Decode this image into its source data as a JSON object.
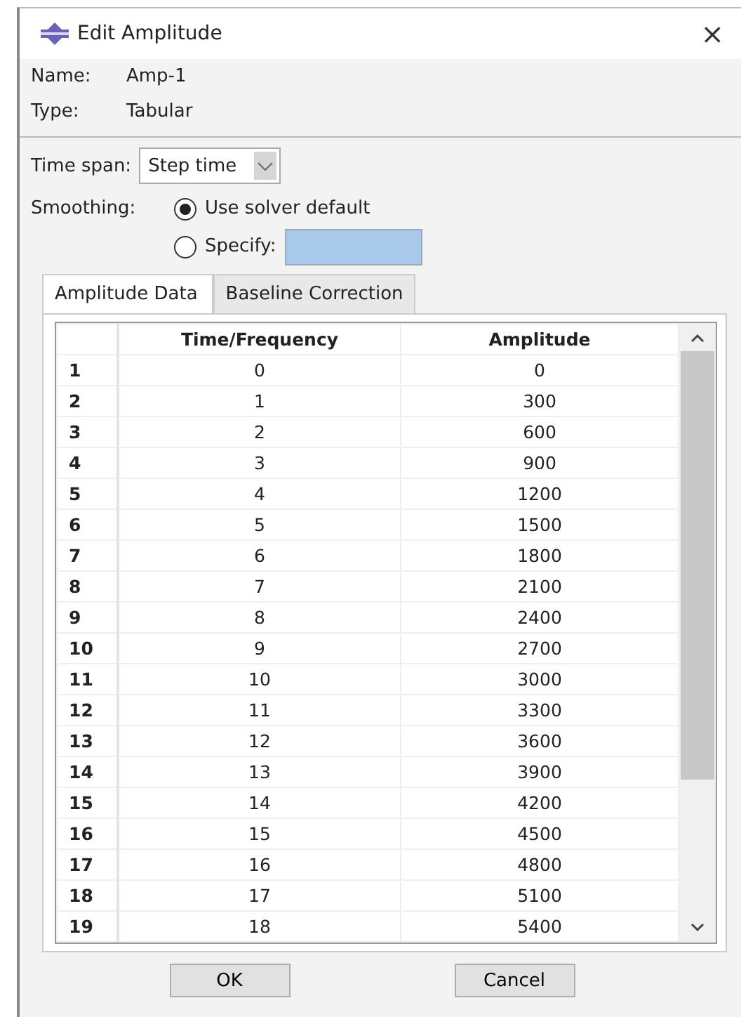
{
  "window": {
    "title": "Edit Amplitude",
    "close": "×"
  },
  "name": {
    "label": "Name:",
    "value": "Amp-1"
  },
  "type": {
    "label": "Type:",
    "value": "Tabular"
  },
  "time_span": {
    "label": "Time span:",
    "value": "Step time"
  },
  "smoothing": {
    "label": "Smoothing:",
    "options": [
      {
        "label": "Use solver default",
        "selected": true,
        "kind": "plain"
      },
      {
        "label": "Specify:",
        "selected": false,
        "kind": "field"
      }
    ]
  },
  "tabs": [
    {
      "label": "Amplitude Data",
      "selected": true
    },
    {
      "label": "Baseline Correction",
      "selected": false
    }
  ],
  "table": {
    "columns": [
      "Time/Frequency",
      "Amplitude"
    ],
    "rows": [
      {
        "index": "1",
        "time": "0",
        "amplitude": "0"
      },
      {
        "index": "2",
        "time": "1",
        "amplitude": "300"
      },
      {
        "index": "3",
        "time": "2",
        "amplitude": "600"
      },
      {
        "index": "4",
        "time": "3",
        "amplitude": "900"
      },
      {
        "index": "5",
        "time": "4",
        "amplitude": "1200"
      },
      {
        "index": "6",
        "time": "5",
        "amplitude": "1500"
      },
      {
        "index": "7",
        "time": "6",
        "amplitude": "1800"
      },
      {
        "index": "8",
        "time": "7",
        "amplitude": "2100"
      },
      {
        "index": "9",
        "time": "8",
        "amplitude": "2400"
      },
      {
        "index": "10",
        "time": "9",
        "amplitude": "2700"
      },
      {
        "index": "11",
        "time": "10",
        "amplitude": "3000"
      },
      {
        "index": "12",
        "time": "11",
        "amplitude": "3300"
      },
      {
        "index": "13",
        "time": "12",
        "amplitude": "3600"
      },
      {
        "index": "14",
        "time": "13",
        "amplitude": "3900"
      },
      {
        "index": "15",
        "time": "14",
        "amplitude": "4200"
      },
      {
        "index": "16",
        "time": "15",
        "amplitude": "4500"
      },
      {
        "index": "17",
        "time": "16",
        "amplitude": "4800"
      },
      {
        "index": "18",
        "time": "17",
        "amplitude": "5100"
      },
      {
        "index": "19",
        "time": "18",
        "amplitude": "5400"
      }
    ]
  },
  "buttons": [
    "OK",
    "Cancel"
  ]
}
